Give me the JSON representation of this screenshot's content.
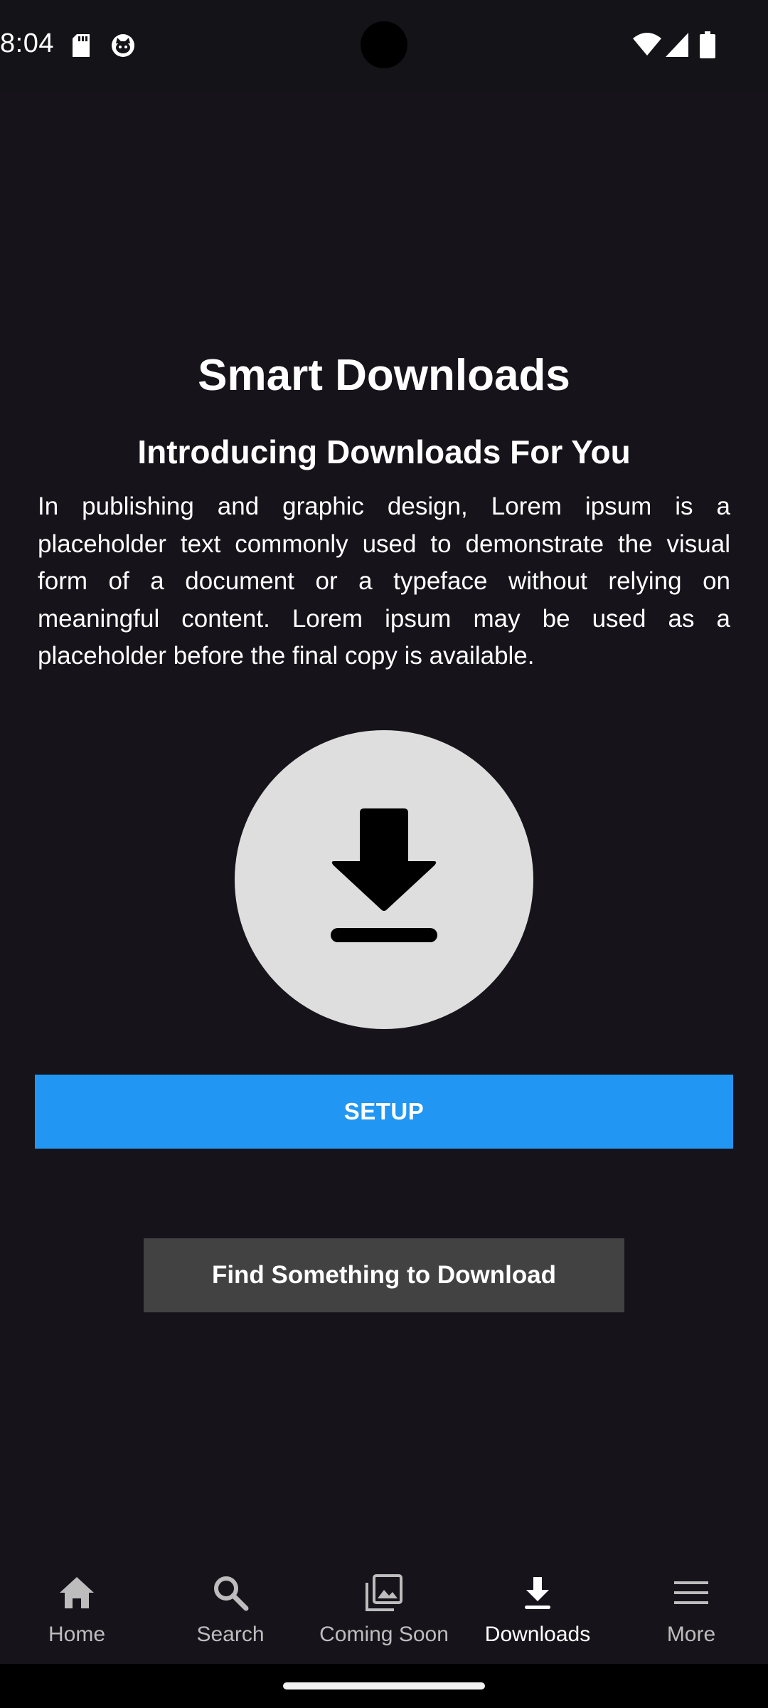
{
  "status_bar": {
    "time": "8:04",
    "left_icons": [
      "sd-card-icon",
      "cat-face-icon"
    ],
    "right_icons": [
      "wifi-icon",
      "signal-icon",
      "battery-icon"
    ]
  },
  "main": {
    "title": "Smart Downloads",
    "subtitle": "Introducing Downloads For You",
    "body": "In publishing and graphic design, Lorem ipsum is a placeholder text commonly used to demonstrate the visual form of a document or a typeface without relying on meaningful content. Lorem ipsum may be used as a placeholder before the final copy is available.",
    "hero_icon": "download-icon",
    "setup_label": "SETUP",
    "find_label": "Find Something to Download"
  },
  "bottom_nav": {
    "items": [
      {
        "label": "Home",
        "icon": "home-icon"
      },
      {
        "label": "Search",
        "icon": "search-icon"
      },
      {
        "label": "Coming Soon",
        "icon": "gallery-icon"
      },
      {
        "label": "Downloads",
        "icon": "download-icon"
      },
      {
        "label": "More",
        "icon": "menu-icon"
      }
    ],
    "active": "Downloads"
  },
  "colors": {
    "background": "#16141a",
    "accent": "#2196f3",
    "secondary_button": "#424242",
    "hero_circle": "#dedede"
  }
}
